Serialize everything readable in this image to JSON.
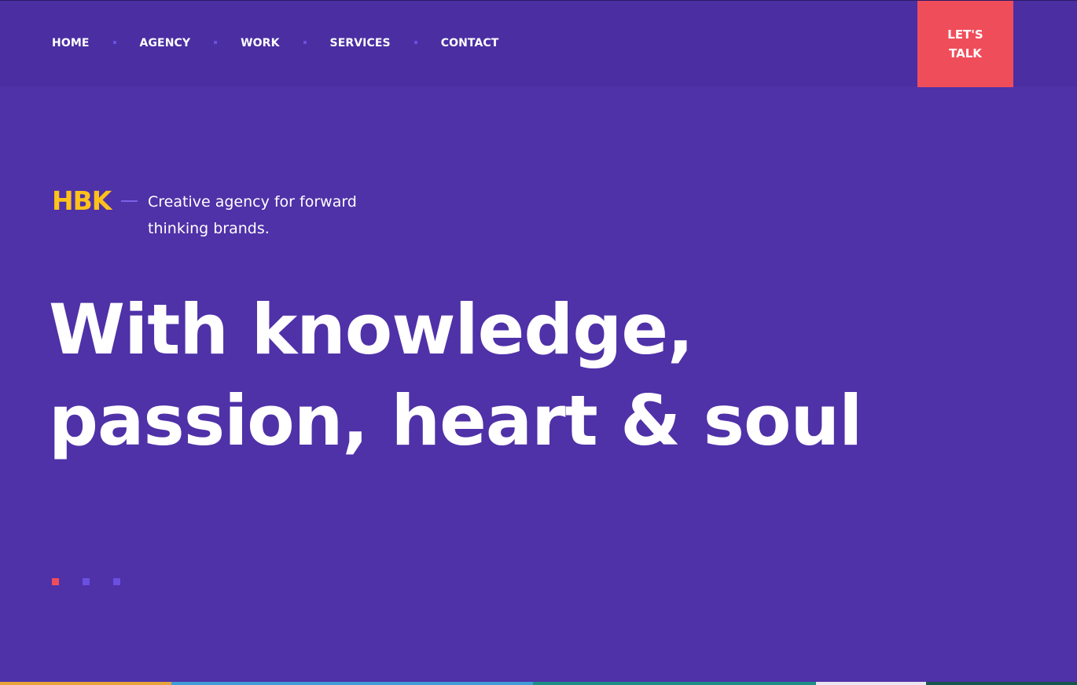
{
  "nav": {
    "items": [
      {
        "label": "HOME"
      },
      {
        "label": "AGENCY"
      },
      {
        "label": "WORK"
      },
      {
        "label": "SERVICES"
      },
      {
        "label": "CONTACT"
      }
    ]
  },
  "cta": {
    "label": "LET'S TALK"
  },
  "brand": {
    "logo_text": "HBK",
    "tagline": "Creative agency for forward thinking brands."
  },
  "hero": {
    "line1": "With knowledge,",
    "line2": "passion, heart & soul"
  },
  "slider": {
    "dot_count": 3,
    "active_index": 0
  },
  "colors": {
    "background": "#4f31a8",
    "header": "#4a2ea2",
    "accent_red": "#f04d5b",
    "brand_yellow": "#ffc21a",
    "dot_purple": "#6a4fe0"
  }
}
